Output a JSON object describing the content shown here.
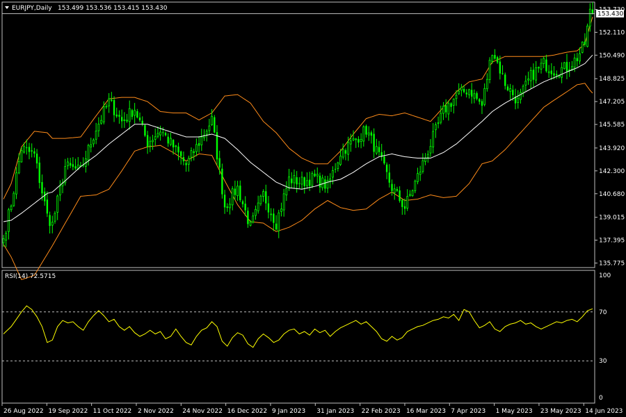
{
  "header": {
    "symbol": "EURJPY,Daily",
    "ohlc": "153.499 153.536 153.415 153.430",
    "current_price_label": "153.430"
  },
  "rsi_panel": {
    "label": "RSI(14) 72.5715"
  },
  "colors": {
    "background": "#000000",
    "bull_candle": "#00ff00",
    "bear_candle": "#00ff00",
    "bands": "#ff8c1a",
    "moving_average": "#ffffff",
    "rsi_line": "#ffff00",
    "price_line": "#c0c0c0",
    "axis_text": "#ffffff",
    "level_line": "#c0c0c0"
  },
  "chart_data": [
    {
      "type": "candlestick",
      "name": "EURJPY",
      "timeframe": "Daily",
      "x_tick_labels": [
        "26 Aug 2022",
        "19 Sep 2022",
        "11 Oct 2022",
        "2 Nov 2022",
        "24 Nov 2022",
        "16 Dec 2022",
        "9 Jan 2023",
        "31 Jan 2023",
        "22 Feb 2023",
        "16 Mar 2023",
        "7 Apr 2023",
        "1 May 2023",
        "23 May 2023",
        "14 Jun 2023"
      ],
      "y_tick_labels": [
        "153.730",
        "152.110",
        "150.490",
        "148.825",
        "147.205",
        "145.585",
        "143.920",
        "142.300",
        "140.680",
        "139.015",
        "137.395",
        "135.775"
      ],
      "ylim": [
        135.6,
        154.1
      ],
      "last_price": 153.43,
      "indicators": [
        "Bollinger Bands",
        "Moving Average"
      ],
      "anchors": [
        {
          "d": 0,
          "c": 137.5,
          "mid": 138.7,
          "w": 1.6
        },
        {
          "d": 3,
          "c": 140.0,
          "mid": 138.8,
          "w": 2.6
        },
        {
          "d": 7,
          "c": 143.9,
          "mid": 139.3,
          "w": 4.7
        },
        {
          "d": 12,
          "c": 143.4,
          "mid": 140.0,
          "w": 5.1
        },
        {
          "d": 17,
          "c": 139.1,
          "mid": 140.7,
          "w": 4.3
        },
        {
          "d": 19,
          "c": 138.5,
          "mid": 140.8,
          "w": 3.8
        },
        {
          "d": 24,
          "c": 142.6,
          "mid": 141.6,
          "w": 3.0
        },
        {
          "d": 30,
          "c": 142.3,
          "mid": 142.6,
          "w": 2.1
        },
        {
          "d": 36,
          "c": 145.3,
          "mid": 143.4,
          "w": 2.8
        },
        {
          "d": 41,
          "c": 147.2,
          "mid": 144.2,
          "w": 3.2
        },
        {
          "d": 46,
          "c": 145.8,
          "mid": 144.9,
          "w": 2.6
        },
        {
          "d": 51,
          "c": 146.7,
          "mid": 145.6,
          "w": 1.9
        },
        {
          "d": 56,
          "c": 144.3,
          "mid": 145.6,
          "w": 1.6
        },
        {
          "d": 61,
          "c": 145.2,
          "mid": 145.3,
          "w": 1.2
        },
        {
          "d": 66,
          "c": 144.0,
          "mid": 145.0,
          "w": 1.4
        },
        {
          "d": 71,
          "c": 142.7,
          "mid": 144.7,
          "w": 1.7
        },
        {
          "d": 76,
          "c": 144.3,
          "mid": 144.7,
          "w": 1.2
        },
        {
          "d": 81,
          "c": 145.9,
          "mid": 144.9,
          "w": 1.5
        },
        {
          "d": 86,
          "c": 139.8,
          "mid": 144.6,
          "w": 3.0
        },
        {
          "d": 91,
          "c": 141.1,
          "mid": 143.8,
          "w": 3.9
        },
        {
          "d": 96,
          "c": 138.3,
          "mid": 142.9,
          "w": 4.2
        },
        {
          "d": 101,
          "c": 140.6,
          "mid": 142.2,
          "w": 3.6
        },
        {
          "d": 106,
          "c": 138.6,
          "mid": 141.5,
          "w": 3.5
        },
        {
          "d": 111,
          "c": 141.7,
          "mid": 141.1,
          "w": 2.8
        },
        {
          "d": 116,
          "c": 141.5,
          "mid": 141.0,
          "w": 2.2
        },
        {
          "d": 121,
          "c": 141.8,
          "mid": 141.2,
          "w": 1.6
        },
        {
          "d": 126,
          "c": 141.2,
          "mid": 141.5,
          "w": 1.3
        },
        {
          "d": 131,
          "c": 143.6,
          "mid": 141.7,
          "w": 2.0
        },
        {
          "d": 136,
          "c": 144.4,
          "mid": 142.2,
          "w": 2.7
        },
        {
          "d": 141,
          "c": 145.2,
          "mid": 142.8,
          "w": 3.2
        },
        {
          "d": 146,
          "c": 143.3,
          "mid": 143.3,
          "w": 3.0
        },
        {
          "d": 151,
          "c": 141.1,
          "mid": 143.5,
          "w": 2.7
        },
        {
          "d": 156,
          "c": 139.7,
          "mid": 143.3,
          "w": 3.1
        },
        {
          "d": 161,
          "c": 141.9,
          "mid": 143.2,
          "w": 2.9
        },
        {
          "d": 166,
          "c": 144.2,
          "mid": 143.2,
          "w": 2.6
        },
        {
          "d": 171,
          "c": 146.5,
          "mid": 143.6,
          "w": 3.2
        },
        {
          "d": 176,
          "c": 147.6,
          "mid": 144.2,
          "w": 3.7
        },
        {
          "d": 181,
          "c": 148.1,
          "mid": 145.0,
          "w": 3.6
        },
        {
          "d": 186,
          "c": 146.9,
          "mid": 145.8,
          "w": 3.0
        },
        {
          "d": 190,
          "c": 150.9,
          "mid": 146.5,
          "w": 3.5
        },
        {
          "d": 195,
          "c": 148.5,
          "mid": 147.1,
          "w": 3.3
        },
        {
          "d": 200,
          "c": 147.2,
          "mid": 147.6,
          "w": 2.8
        },
        {
          "d": 205,
          "c": 149.0,
          "mid": 148.1,
          "w": 2.3
        },
        {
          "d": 210,
          "c": 149.9,
          "mid": 148.6,
          "w": 1.8
        },
        {
          "d": 214,
          "c": 149.4,
          "mid": 148.9,
          "w": 1.6
        },
        {
          "d": 219,
          "c": 149.6,
          "mid": 149.3,
          "w": 1.4
        },
        {
          "d": 223,
          "c": 150.3,
          "mid": 149.6,
          "w": 1.2
        },
        {
          "d": 226,
          "c": 151.3,
          "mid": 149.9,
          "w": 1.4
        },
        {
          "d": 228,
          "c": 153.5,
          "mid": 150.3,
          "w": 2.3
        },
        {
          "d": 229,
          "c": 153.43,
          "mid": 150.5,
          "w": 2.7
        }
      ]
    },
    {
      "type": "line",
      "name": "RSI(14)",
      "last_value": 72.5715,
      "ylim": [
        0,
        100
      ],
      "y_tick_labels": [
        "100",
        "70",
        "30",
        "0"
      ],
      "levels": [
        70,
        30
      ],
      "values": [
        [
          0,
          52
        ],
        [
          3,
          58
        ],
        [
          5,
          64
        ],
        [
          7,
          70
        ],
        [
          9,
          75
        ],
        [
          11,
          72
        ],
        [
          13,
          66
        ],
        [
          15,
          58
        ],
        [
          17,
          45
        ],
        [
          19,
          47
        ],
        [
          21,
          58
        ],
        [
          23,
          63
        ],
        [
          25,
          61
        ],
        [
          27,
          62
        ],
        [
          29,
          58
        ],
        [
          31,
          55
        ],
        [
          33,
          62
        ],
        [
          35,
          67
        ],
        [
          37,
          71
        ],
        [
          39,
          67
        ],
        [
          41,
          62
        ],
        [
          43,
          64
        ],
        [
          45,
          58
        ],
        [
          47,
          55
        ],
        [
          49,
          58
        ],
        [
          51,
          53
        ],
        [
          53,
          50
        ],
        [
          55,
          52
        ],
        [
          57,
          55
        ],
        [
          59,
          52
        ],
        [
          61,
          54
        ],
        [
          63,
          48
        ],
        [
          65,
          50
        ],
        [
          67,
          56
        ],
        [
          69,
          50
        ],
        [
          71,
          45
        ],
        [
          73,
          43
        ],
        [
          75,
          50
        ],
        [
          77,
          55
        ],
        [
          79,
          57
        ],
        [
          81,
          62
        ],
        [
          83,
          58
        ],
        [
          85,
          46
        ],
        [
          87,
          42
        ],
        [
          89,
          49
        ],
        [
          91,
          53
        ],
        [
          93,
          51
        ],
        [
          95,
          44
        ],
        [
          97,
          41
        ],
        [
          99,
          48
        ],
        [
          101,
          52
        ],
        [
          103,
          49
        ],
        [
          105,
          45
        ],
        [
          107,
          47
        ],
        [
          109,
          52
        ],
        [
          111,
          55
        ],
        [
          113,
          56
        ],
        [
          115,
          52
        ],
        [
          117,
          54
        ],
        [
          119,
          51
        ],
        [
          121,
          56
        ],
        [
          123,
          53
        ],
        [
          125,
          55
        ],
        [
          127,
          50
        ],
        [
          129,
          54
        ],
        [
          131,
          57
        ],
        [
          133,
          59
        ],
        [
          135,
          61
        ],
        [
          137,
          63
        ],
        [
          139,
          60
        ],
        [
          141,
          62
        ],
        [
          143,
          58
        ],
        [
          145,
          54
        ],
        [
          147,
          48
        ],
        [
          149,
          46
        ],
        [
          151,
          50
        ],
        [
          153,
          47
        ],
        [
          155,
          49
        ],
        [
          157,
          54
        ],
        [
          159,
          56
        ],
        [
          161,
          58
        ],
        [
          163,
          59
        ],
        [
          165,
          61
        ],
        [
          167,
          63
        ],
        [
          169,
          64
        ],
        [
          171,
          66
        ],
        [
          173,
          65
        ],
        [
          175,
          68
        ],
        [
          177,
          63
        ],
        [
          179,
          72
        ],
        [
          181,
          70
        ],
        [
          183,
          63
        ],
        [
          185,
          57
        ],
        [
          187,
          59
        ],
        [
          189,
          62
        ],
        [
          191,
          56
        ],
        [
          193,
          54
        ],
        [
          195,
          58
        ],
        [
          197,
          60
        ],
        [
          199,
          61
        ],
        [
          201,
          63
        ],
        [
          203,
          60
        ],
        [
          205,
          61
        ],
        [
          207,
          58
        ],
        [
          209,
          56
        ],
        [
          211,
          58
        ],
        [
          213,
          60
        ],
        [
          215,
          62
        ],
        [
          217,
          61
        ],
        [
          219,
          63
        ],
        [
          221,
          64
        ],
        [
          223,
          62
        ],
        [
          225,
          66
        ],
        [
          227,
          71
        ],
        [
          229,
          72.57
        ]
      ]
    }
  ]
}
